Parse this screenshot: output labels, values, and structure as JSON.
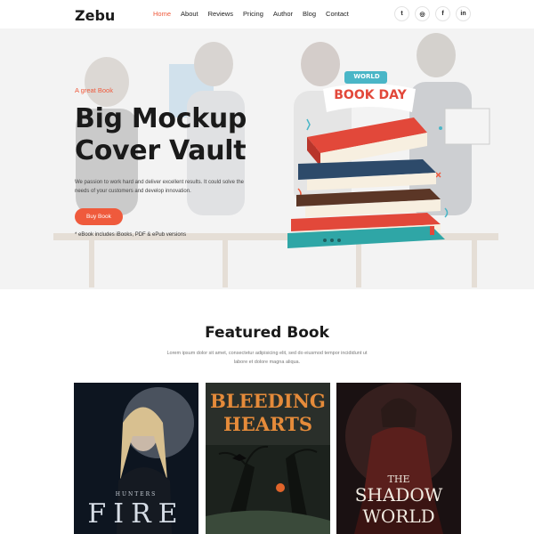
{
  "nav": {
    "logo": "Zebu",
    "items": [
      {
        "label": "Home",
        "active": true
      },
      {
        "label": "About"
      },
      {
        "label": "Reviews"
      },
      {
        "label": "Pricing"
      },
      {
        "label": "Author"
      },
      {
        "label": "Blog"
      },
      {
        "label": "Contact"
      }
    ],
    "socials": [
      {
        "icon": "twitter-icon",
        "glyph": "t"
      },
      {
        "icon": "instagram-icon",
        "glyph": "◎"
      },
      {
        "icon": "facebook-icon",
        "glyph": "f"
      },
      {
        "icon": "linkedin-icon",
        "glyph": "in"
      }
    ]
  },
  "hero": {
    "kicker": "A great Book",
    "title_line1": "Big Mockup",
    "title_line2": "Cover Vault",
    "description": "We passion to work hard and deliver excellent results. It could solve the needs of your customers and develop innovation.",
    "button": "Buy Book",
    "note": "* eBook includes iBooks, PDF & ePub versions",
    "badge_top": "WORLD",
    "badge_main": "BOOK DAY"
  },
  "featured": {
    "title": "Featured Book",
    "description": "Lorem ipsum dolor sit amet, consectetur adipisicing elit, sed do eiusmod tempor incididunt ut labore et dolore magna aliqua.",
    "books": [
      {
        "small": "HUNTERS",
        "title": "FIRE"
      },
      {
        "title_line1": "BLEEDING",
        "title_line2": "HEARTS"
      },
      {
        "small": "THE",
        "title": "SHADOW",
        "title2": "WORLD"
      }
    ]
  },
  "colors": {
    "accent": "#ef5a3c",
    "text_dark": "#1a1a1a"
  }
}
